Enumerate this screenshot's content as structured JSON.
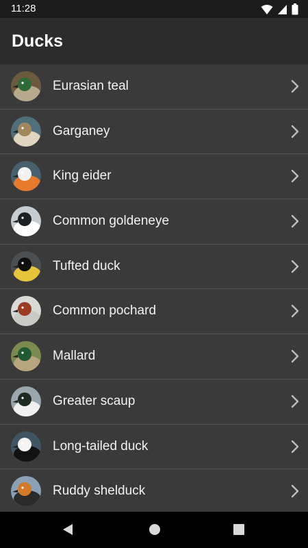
{
  "status_bar": {
    "time": "11:28",
    "icons": [
      "wifi-icon",
      "signal-icon",
      "battery-icon"
    ]
  },
  "app_bar": {
    "title": "Ducks"
  },
  "birds": [
    {
      "name": "Eurasian teal",
      "colors": [
        "#6b5a3e",
        "#2f6b3a",
        "#b7a98c"
      ]
    },
    {
      "name": "Garganey",
      "colors": [
        "#4f6f7a",
        "#a0875d",
        "#e0d6c0"
      ]
    },
    {
      "name": "King eider",
      "colors": [
        "#46606e",
        "#f2f2f2",
        "#e87a2c"
      ]
    },
    {
      "name": "Common goldeneye",
      "colors": [
        "#c7ccd1",
        "#1d1f22",
        "#ffffff"
      ]
    },
    {
      "name": "Tufted duck",
      "colors": [
        "#4c4f52",
        "#0f0f10",
        "#e6c53a"
      ]
    },
    {
      "name": "Common pochard",
      "colors": [
        "#d9d9d6",
        "#9a3b22",
        "#c9c9c6"
      ]
    },
    {
      "name": "Mallard",
      "colors": [
        "#7b8a4f",
        "#1f5a33",
        "#b9a57f"
      ]
    },
    {
      "name": "Greater scaup",
      "colors": [
        "#9aa7ae",
        "#1c2a22",
        "#f0f0f0"
      ]
    },
    {
      "name": "Long-tailed duck",
      "colors": [
        "#3f5564",
        "#f4f4f4",
        "#111111"
      ]
    },
    {
      "name": "Ruddy shelduck",
      "colors": [
        "#8aa1b5",
        "#d27a2a",
        "#2a2a2a"
      ]
    }
  ],
  "nav_bar": {
    "buttons": [
      "back-button",
      "home-button",
      "recents-button"
    ]
  }
}
